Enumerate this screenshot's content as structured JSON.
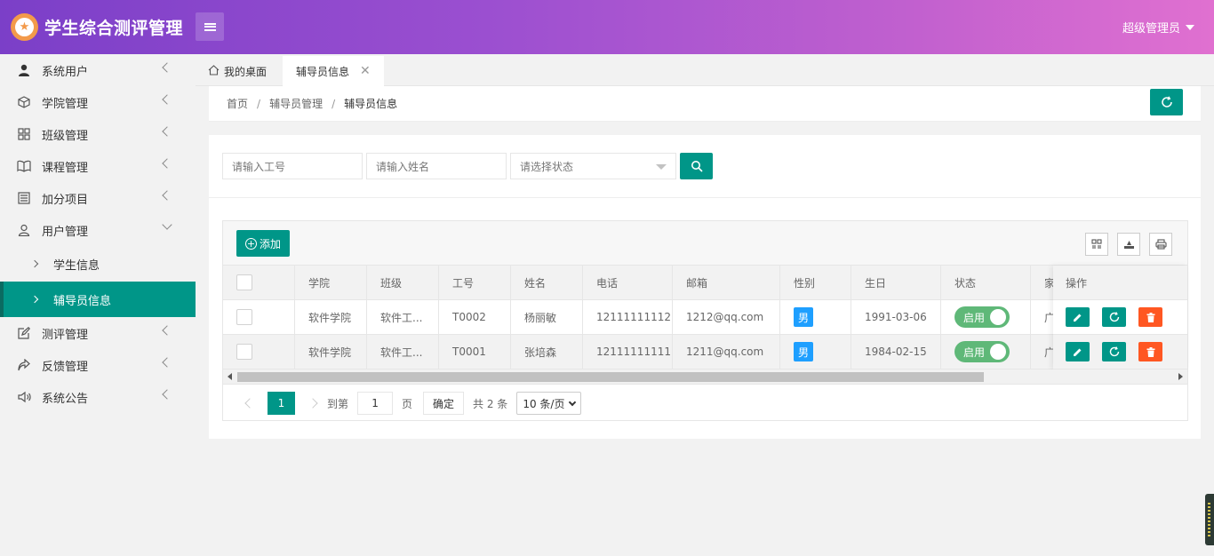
{
  "header": {
    "logo_icon": "star-badge-icon",
    "title": "学生综合测评管理",
    "user": "超级管理员"
  },
  "sidebar": {
    "items": [
      {
        "label": "系统用户",
        "icon": "user-solid-icon"
      },
      {
        "label": "学院管理",
        "icon": "cube-icon"
      },
      {
        "label": "班级管理",
        "icon": "grid-icon"
      },
      {
        "label": "课程管理",
        "icon": "book-icon"
      },
      {
        "label": "加分项目",
        "icon": "list-icon"
      },
      {
        "label": "用户管理",
        "icon": "user-outline-icon",
        "expanded": true
      },
      {
        "label": "测评管理",
        "icon": "edit-icon"
      },
      {
        "label": "反馈管理",
        "icon": "share-icon"
      },
      {
        "label": "系统公告",
        "icon": "speaker-icon"
      }
    ],
    "sub_items": [
      {
        "label": "学生信息"
      },
      {
        "label": "辅导员信息",
        "active": true
      }
    ]
  },
  "tabs": {
    "home": "我的桌面",
    "active": "辅导员信息"
  },
  "breadcrumb": [
    "首页",
    "辅导员管理",
    "辅导员信息"
  ],
  "search": {
    "id_placeholder": "请输入工号",
    "name_placeholder": "请输入姓名",
    "status_placeholder": "请选择状态"
  },
  "toolbar": {
    "add_label": "添加"
  },
  "table": {
    "columns": [
      "学院",
      "班级",
      "工号",
      "姓名",
      "电话",
      "邮箱",
      "性别",
      "生日",
      "状态",
      "家",
      "操作"
    ],
    "rows": [
      {
        "college": "软件学院",
        "class": "软件工...",
        "id": "T0002",
        "name": "杨丽敏",
        "phone": "12111111112",
        "email": "1212@qq.com",
        "gender": "男",
        "birthday": "1991-03-06",
        "status": "启用",
        "home": "广"
      },
      {
        "college": "软件学院",
        "class": "软件工...",
        "id": "T0001",
        "name": "张培森",
        "phone": "12111111111",
        "email": "1211@qq.com",
        "gender": "男",
        "birthday": "1984-02-15",
        "status": "启用",
        "home": "广"
      }
    ]
  },
  "pager": {
    "current": "1",
    "goto_label": "到第",
    "page_input": "1",
    "page_unit": "页",
    "ok_label": "确定",
    "total": "共 2 条",
    "page_size": "10 条/页"
  },
  "colors": {
    "primary": "#009688",
    "danger": "#ff5722",
    "info": "#1e9fff",
    "switch_on": "#5fb878"
  }
}
